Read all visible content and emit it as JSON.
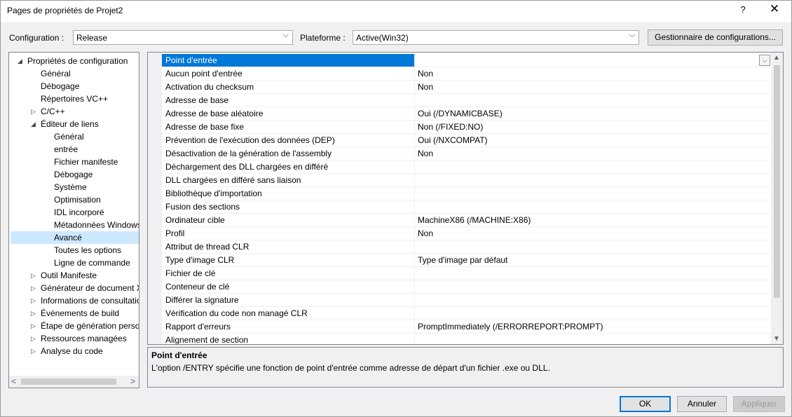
{
  "window": {
    "title": "Pages de propriétés de Projet2",
    "help_label": "?",
    "close_label": "✕"
  },
  "toolbar": {
    "configuration_label": "Configuration :",
    "configuration_value": "Release",
    "platform_label": "Plateforme :",
    "platform_value": "Active(Win32)",
    "config_manager_label": "Gestionnaire de configurations..."
  },
  "tree": {
    "items": [
      {
        "label": "Propriétés de configuration",
        "level": 0,
        "expander": "◢"
      },
      {
        "label": "Général",
        "level": 1,
        "expander": ""
      },
      {
        "label": "Débogage",
        "level": 1,
        "expander": ""
      },
      {
        "label": "Répertoires VC++",
        "level": 1,
        "expander": ""
      },
      {
        "label": "C/C++",
        "level": 1,
        "expander": "▷"
      },
      {
        "label": "Éditeur de liens",
        "level": 1,
        "expander": "◢"
      },
      {
        "label": "Général",
        "level": 2,
        "expander": ""
      },
      {
        "label": "entrée",
        "level": 2,
        "expander": ""
      },
      {
        "label": "Fichier manifeste",
        "level": 2,
        "expander": ""
      },
      {
        "label": "Débogage",
        "level": 2,
        "expander": ""
      },
      {
        "label": "Système",
        "level": 2,
        "expander": ""
      },
      {
        "label": "Optimisation",
        "level": 2,
        "expander": ""
      },
      {
        "label": "IDL incorporé",
        "level": 2,
        "expander": ""
      },
      {
        "label": "Métadonnées Windows",
        "level": 2,
        "expander": ""
      },
      {
        "label": "Avancé",
        "level": 2,
        "expander": "",
        "selected": true
      },
      {
        "label": "Toutes les options",
        "level": 2,
        "expander": ""
      },
      {
        "label": "Ligne de commande",
        "level": 2,
        "expander": ""
      },
      {
        "label": "Outil Manifeste",
        "level": 1,
        "expander": "▷"
      },
      {
        "label": "Générateur de document XML",
        "level": 1,
        "expander": "▷"
      },
      {
        "label": "Informations de consultation",
        "level": 1,
        "expander": "▷"
      },
      {
        "label": "Événements de build",
        "level": 1,
        "expander": "▷"
      },
      {
        "label": "Étape de génération personnalisée",
        "level": 1,
        "expander": "▷"
      },
      {
        "label": "Ressources managées",
        "level": 1,
        "expander": "▷"
      },
      {
        "label": "Analyse du code",
        "level": 1,
        "expander": "▷"
      }
    ],
    "scroll_left": "<",
    "scroll_right": ">"
  },
  "grid": {
    "rows": [
      {
        "name": "Point d'entrée",
        "value": "",
        "selected": true
      },
      {
        "name": "Aucun point d'entrée",
        "value": "Non"
      },
      {
        "name": "Activation du checksum",
        "value": "Non"
      },
      {
        "name": "Adresse de base",
        "value": ""
      },
      {
        "name": "Adresse de base aléatoire",
        "value": "Oui (/DYNAMICBASE)"
      },
      {
        "name": "Adresse de base fixe",
        "value": "Non (/FIXED:NO)"
      },
      {
        "name": "Prévention de l'exécution des données (DEP)",
        "value": "Oui (/NXCOMPAT)"
      },
      {
        "name": "Désactivation de la génération de l'assembly",
        "value": "Non"
      },
      {
        "name": "Déchargement des DLL chargées en différé",
        "value": ""
      },
      {
        "name": "DLL chargées en différé sans liaison",
        "value": ""
      },
      {
        "name": "Bibliothèque d'importation",
        "value": ""
      },
      {
        "name": "Fusion des sections",
        "value": ""
      },
      {
        "name": "Ordinateur cible",
        "value": "MachineX86 (/MACHINE:X86)"
      },
      {
        "name": "Profil",
        "value": "Non"
      },
      {
        "name": "Attribut de thread CLR",
        "value": ""
      },
      {
        "name": "Type d'image CLR",
        "value": "Type d'image par défaut"
      },
      {
        "name": "Fichier de clé",
        "value": ""
      },
      {
        "name": "Conteneur de clé",
        "value": ""
      },
      {
        "name": "Différer la signature",
        "value": ""
      },
      {
        "name": "Vérification du code non managé CLR",
        "value": ""
      },
      {
        "name": "Rapport d'erreurs",
        "value": "PromptImmediately (/ERRORREPORT:PROMPT)"
      },
      {
        "name": "Alignement de section",
        "value": ""
      }
    ]
  },
  "description": {
    "title": "Point d'entrée",
    "text": "L'option /ENTRY spécifie une fonction de point d'entrée comme adresse de départ d'un fichier .exe ou DLL."
  },
  "buttons": {
    "ok": "OK",
    "cancel": "Annuler",
    "apply": "Appliquer"
  }
}
